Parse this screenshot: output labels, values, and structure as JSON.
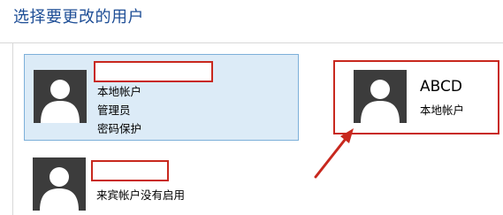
{
  "page": {
    "title": "选择要更改的用户"
  },
  "accounts": [
    {
      "name": "",
      "details": [
        "本地帐户",
        "管理员",
        "密码保护"
      ],
      "selected": true
    },
    {
      "name": "",
      "details": [
        "来宾帐户没有启用"
      ],
      "selected": false
    },
    {
      "name": "ABCD",
      "details": [
        "本地帐户"
      ],
      "selected": false
    }
  ],
  "annotation": {
    "color": "#c8281e"
  },
  "colors": {
    "title": "#1e4e96",
    "selected_tile_bg": "#dcebf7",
    "selected_tile_border": "#7db0d9",
    "avatar_bg": "#3c3c3c"
  },
  "icons": [
    "user-avatar-icon",
    "annotation-arrow-icon"
  ]
}
